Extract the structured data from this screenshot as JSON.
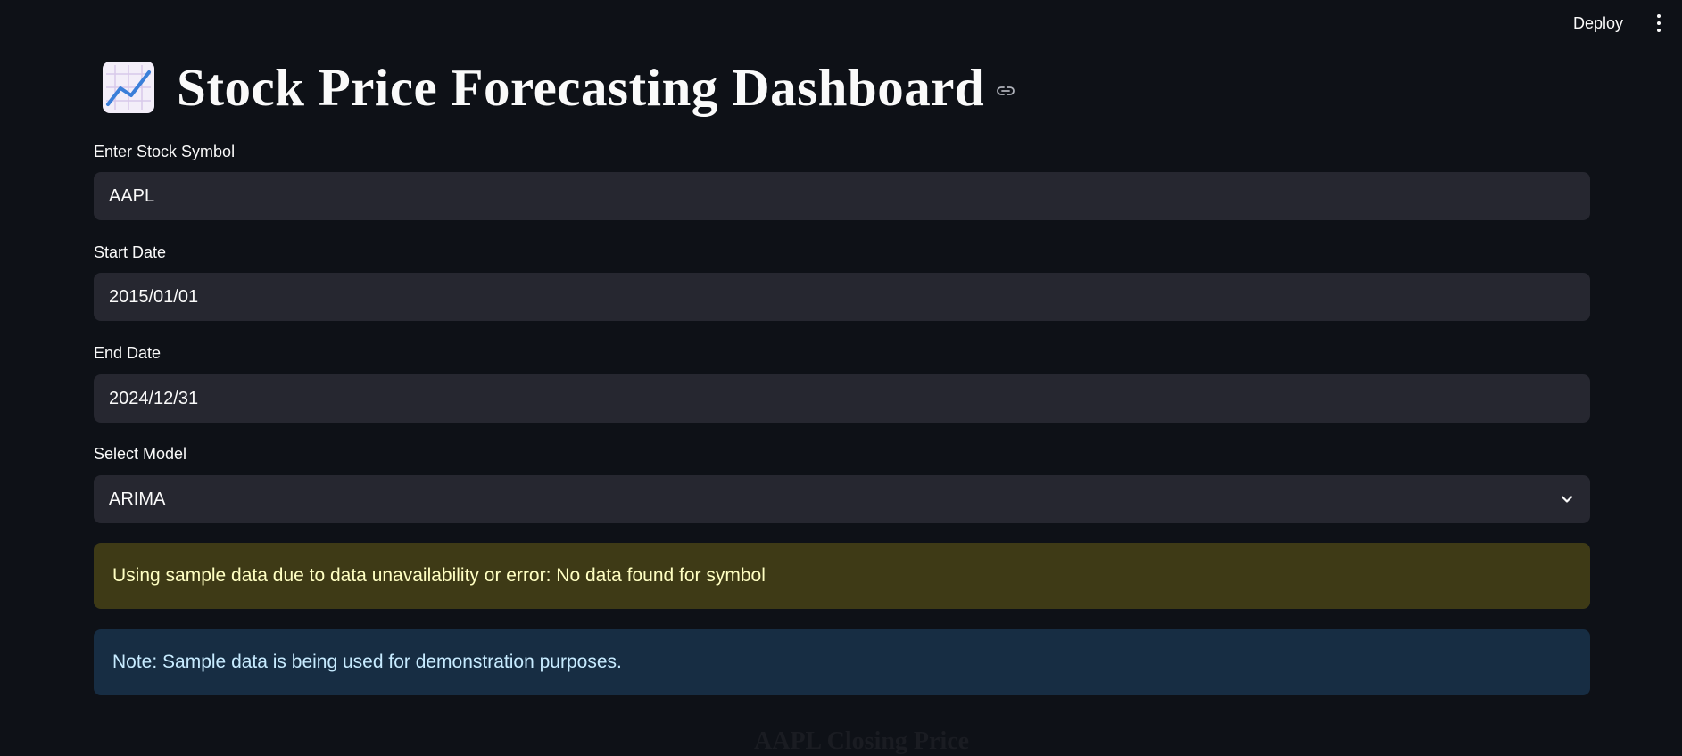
{
  "header": {
    "deploy_label": "Deploy",
    "menu_icon": "vertical-ellipsis-icon"
  },
  "page": {
    "title_icon": "chart-increasing-icon",
    "title": "Stock Price Forecasting Dashboard",
    "anchor_icon": "link-icon"
  },
  "form": {
    "symbol": {
      "label": "Enter Stock Symbol",
      "value": "AAPL"
    },
    "start_date": {
      "label": "Start Date",
      "value": "2015/01/01"
    },
    "end_date": {
      "label": "End Date",
      "value": "2024/12/31"
    },
    "model": {
      "label": "Select Model",
      "value": "ARIMA",
      "icon": "chevron-down-icon"
    }
  },
  "alerts": {
    "warning": "Using sample data due to data unavailability or error: No data found for symbol",
    "info": "Note: Sample data is being used for demonstration purposes."
  },
  "chart_peek": {
    "title": "AAPL Closing Price"
  },
  "colors": {
    "background": "#0e1117",
    "input_bg": "#262730",
    "warning_bg": "#3e3a16",
    "warning_text": "#ffffc2",
    "info_bg": "#172d43",
    "info_text": "#c7ebff"
  }
}
